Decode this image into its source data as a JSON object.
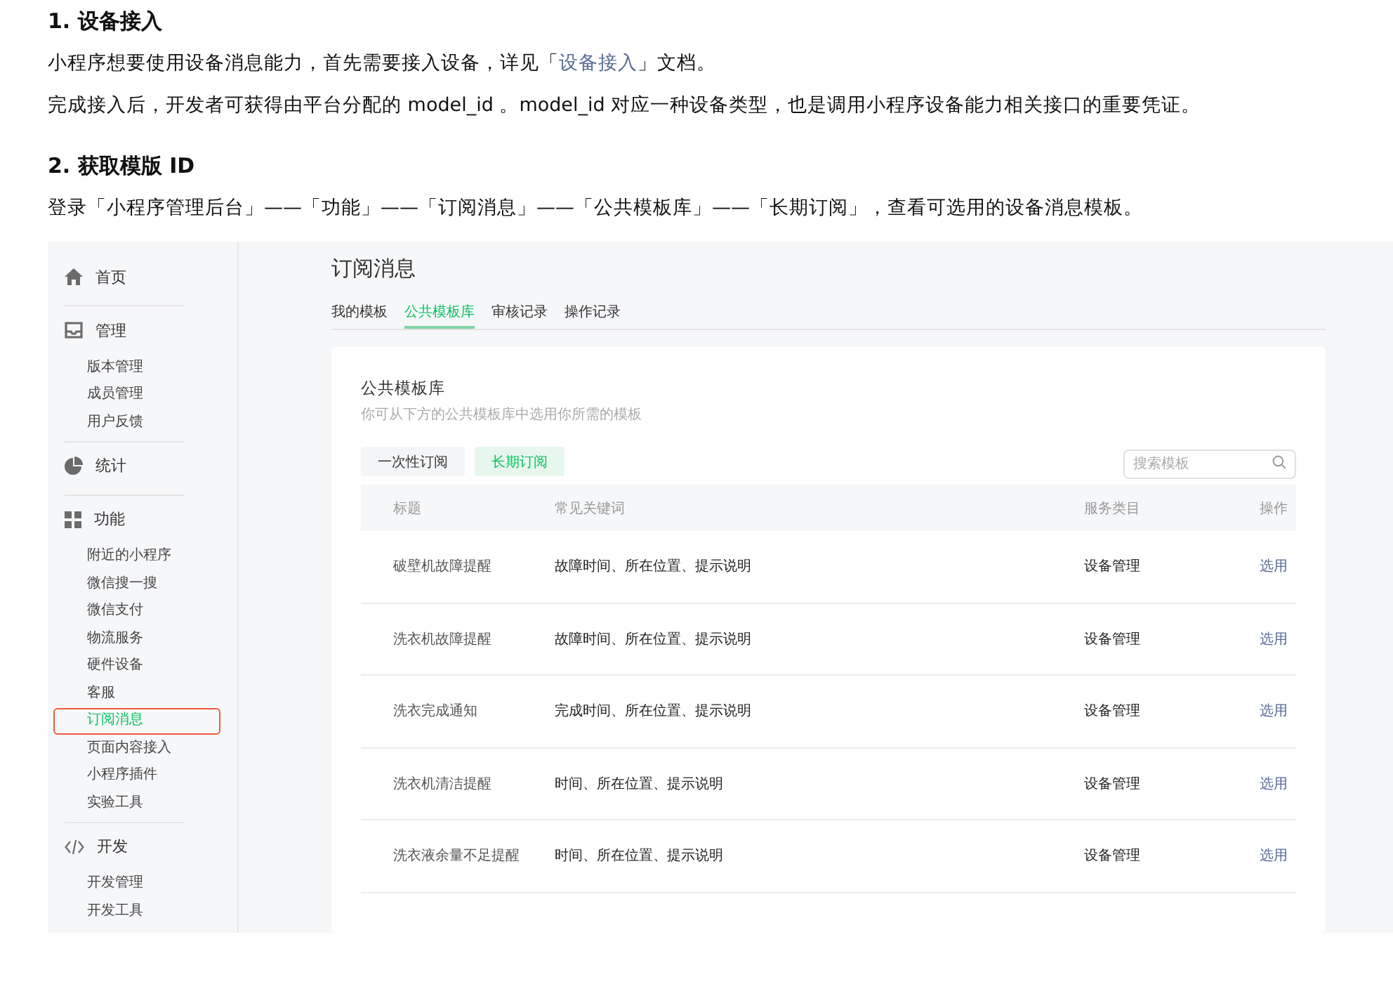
{
  "doc": [
    {
      "heading": "1. 设备接入",
      "paragraphs": [
        [
          {
            "kind": "text",
            "text": "小程序想要使用设备消息能力，首先需要接入设备，详见「"
          },
          {
            "kind": "link",
            "text": "设备接入"
          },
          {
            "kind": "text",
            "text": "」文档。"
          }
        ],
        [
          {
            "kind": "text",
            "text": "完成接入后，开发者可获得由平台分配的 model_id 。model_id 对应一种设备类型，也是调用小程序设备能力相关接口的重要凭证。"
          }
        ]
      ]
    },
    {
      "heading": "2. 获取模版 ID",
      "paragraphs": [
        [
          {
            "kind": "text",
            "text": "登录「小程序管理后台」——「功能」——「订阅消息」——「公共模板库」——「长期订阅」，查看可选用的设备消息模板。"
          }
        ]
      ]
    }
  ],
  "screenshot": {
    "sidebar": [
      {
        "kind": "home",
        "label": "首页"
      },
      {
        "kind": "tray",
        "label": "管理",
        "children": [
          {
            "label": "版本管理",
            "selected": false
          },
          {
            "label": "成员管理",
            "selected": false
          },
          {
            "label": "用户反馈",
            "selected": false
          }
        ]
      },
      {
        "kind": "pie",
        "label": "统计"
      },
      {
        "kind": "grid",
        "label": "功能",
        "children": [
          {
            "label": "附近的小程序",
            "selected": false
          },
          {
            "label": "微信搜一搜",
            "selected": false
          },
          {
            "label": "微信支付",
            "selected": false
          },
          {
            "label": "物流服务",
            "selected": false
          },
          {
            "label": "硬件设备",
            "selected": false
          },
          {
            "label": "客服",
            "selected": false
          },
          {
            "label": "订阅消息",
            "selected": true
          },
          {
            "label": "页面内容接入",
            "selected": false
          },
          {
            "label": "小程序插件",
            "selected": false
          },
          {
            "label": "实验工具",
            "selected": false
          }
        ]
      },
      {
        "kind": "code",
        "label": "开发",
        "children": [
          {
            "label": "开发管理",
            "selected": false
          },
          {
            "label": "开发工具",
            "selected": false
          }
        ]
      }
    ],
    "title": "订阅消息",
    "tabs": [
      {
        "label": "我的模板",
        "selected": false
      },
      {
        "label": "公共模板库",
        "selected": true
      },
      {
        "label": "审核记录",
        "selected": false
      },
      {
        "label": "操作记录",
        "selected": false
      }
    ],
    "card": {
      "title": "公共模板库",
      "subtitle": "你可从下方的公共模板库中选用你所需的模板",
      "filters": [
        {
          "label": "一次性订阅",
          "selected": false
        },
        {
          "label": "长期订阅",
          "selected": true
        }
      ],
      "search": {
        "placeholder": "搜索模板"
      },
      "columns": [
        "标题",
        "常见关键词",
        "服务类目",
        "操作"
      ],
      "rows": [
        {
          "title": "破壁机故障提醒",
          "keywords": "故障时间、所在位置、提示说明",
          "category": "设备管理",
          "action": "选用"
        },
        {
          "title": "洗衣机故障提醒",
          "keywords": "故障时间、所在位置、提示说明",
          "category": "设备管理",
          "action": "选用"
        },
        {
          "title": "洗衣完成通知",
          "keywords": "完成时间、所在位置、提示说明",
          "category": "设备管理",
          "action": "选用"
        },
        {
          "title": "洗衣机清洁提醒",
          "keywords": "时间、所在位置、提示说明",
          "category": "设备管理",
          "action": "选用"
        },
        {
          "title": "洗衣液余量不足提醒",
          "keywords": "时间、所在位置、提示说明",
          "category": "设备管理",
          "action": "选用"
        }
      ]
    }
  }
}
